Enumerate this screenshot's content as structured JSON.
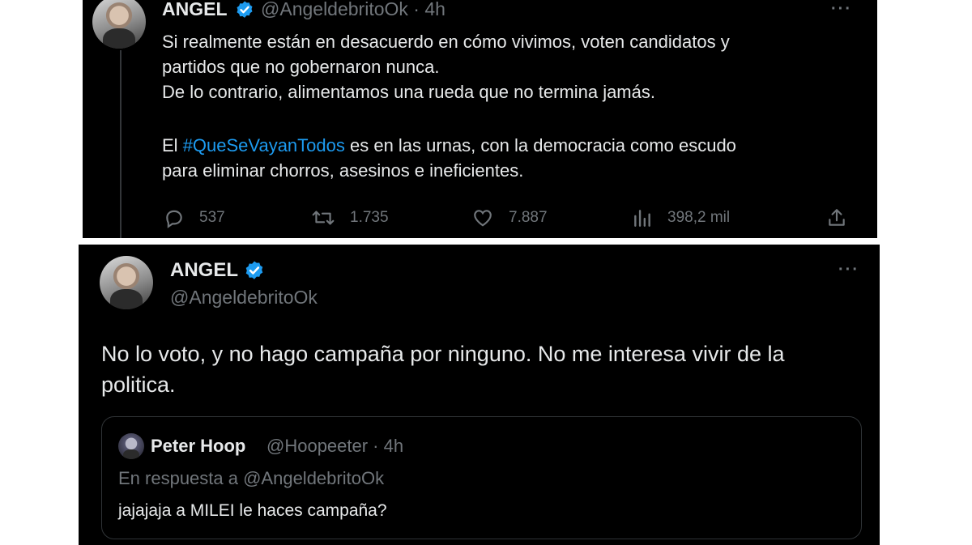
{
  "tweet1": {
    "author_name": "ANGEL",
    "handle_time": "@AngeldebritoOk · 4h",
    "more": "···",
    "text_lines": [
      "Si realmente están en desacuerdo en cómo vivimos, voten candidatos y",
      "partidos que no gobernaron nunca.",
      "De lo contrario, alimentamos una rueda que no termina jamás."
    ],
    "text2_prefix": "El ",
    "hashtag": "#QueSeVayanTodos",
    "text2_suffix": " es en las urnas, con la democracia como escudo",
    "text2_line2": "para eliminar chorros, asesinos e ineficientes.",
    "replies": "537",
    "retweets": "1.735",
    "likes": "7.887",
    "views": "398,2 mil"
  },
  "tweet2": {
    "author_name": "ANGEL",
    "handle": "@AngeldebritoOk",
    "more": "···",
    "text_lines": [
      "No lo voto, y no hago campaña por ninguno. No me interesa vivir de la",
      "politica."
    ],
    "quote": {
      "author_name": "Peter Hoop",
      "handle_time": "@Hoopeeter · 4h",
      "reply_context": "En respuesta a @AngeldebritoOk",
      "text": "jajajaja a MILEI le haces campaña?"
    }
  },
  "colors": {
    "background": "#000000",
    "text": "#e7e9ea",
    "secondary": "#71767b",
    "accent": "#1d9bf0"
  },
  "icons": [
    "verified-badge-icon",
    "more-icon",
    "reply-icon",
    "retweet-icon",
    "like-icon",
    "views-icon",
    "share-icon"
  ]
}
